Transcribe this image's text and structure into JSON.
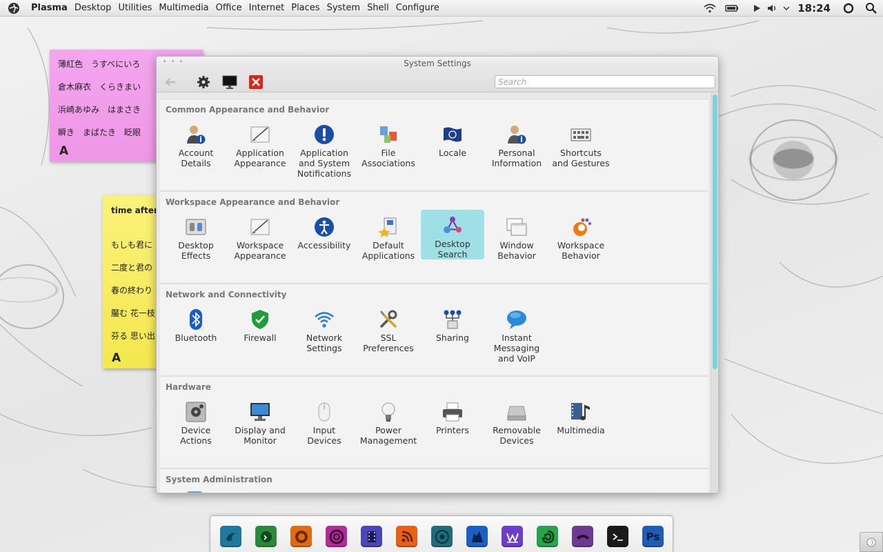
{
  "top_panel": {
    "menus": [
      "Plasma",
      "Desktop",
      "Utilities",
      "Multimedia",
      "Office",
      "Internet",
      "Places",
      "System",
      "Shell",
      "Configure"
    ],
    "clock": "18:24"
  },
  "notes": {
    "pink": {
      "lines": [
        "薄紅色　うすべにいろ",
        "倉木麻衣　くらきまい",
        "浜崎あゆみ　はまさき",
        "瞬き　まばたき　眨眼"
      ],
      "font_icon": "A"
    },
    "yellow": {
      "lines": [
        "time after",
        "もしも君に",
        "二度と君の",
        "春の終わり",
        "靨む 花一枝",
        "芬る 思い出"
      ],
      "font_icon": "A"
    }
  },
  "window": {
    "title": "System Settings",
    "search_placeholder": "Search",
    "sections": [
      {
        "title": "Common Appearance and Behavior",
        "items": [
          {
            "label": "Account\nDetails",
            "icon": "user-info-icon"
          },
          {
            "label": "Application\nAppearance",
            "icon": "appearance-icon"
          },
          {
            "label": "Application\nand System\nNotifications",
            "icon": "notification-icon"
          },
          {
            "label": "File\nAssociations",
            "icon": "file-assoc-icon"
          },
          {
            "label": "Locale",
            "icon": "locale-flag-icon"
          },
          {
            "label": "Personal\nInformation",
            "icon": "personal-info-icon"
          },
          {
            "label": "Shortcuts\nand Gestures",
            "icon": "keyboard-icon"
          }
        ]
      },
      {
        "title": "Workspace Appearance and Behavior",
        "items": [
          {
            "label": "Desktop\nEffects",
            "icon": "desktop-effects-icon"
          },
          {
            "label": "Workspace\nAppearance",
            "icon": "workspace-appearance-icon"
          },
          {
            "label": "Accessibility",
            "icon": "accessibility-icon"
          },
          {
            "label": "Default\nApplications",
            "icon": "default-apps-icon"
          },
          {
            "label": "Desktop\nSearch",
            "icon": "desktop-search-icon",
            "highlighted": true
          },
          {
            "label": "Window\nBehavior",
            "icon": "window-behavior-icon"
          },
          {
            "label": "Workspace\nBehavior",
            "icon": "workspace-behavior-icon"
          }
        ]
      },
      {
        "title": "Network and Connectivity",
        "items": [
          {
            "label": "Bluetooth",
            "icon": "bluetooth-icon"
          },
          {
            "label": "Firewall",
            "icon": "firewall-shield-icon"
          },
          {
            "label": "Network\nSettings",
            "icon": "wifi-icon"
          },
          {
            "label": "SSL\nPreferences",
            "icon": "tools-icon"
          },
          {
            "label": "Sharing",
            "icon": "sharing-icon"
          },
          {
            "label": "Instant\nMessaging\nand VoIP",
            "icon": "chat-bubble-icon"
          }
        ]
      },
      {
        "title": "Hardware",
        "items": [
          {
            "label": "Device\nActions",
            "icon": "device-actions-icon"
          },
          {
            "label": "Display and\nMonitor",
            "icon": "monitor-icon"
          },
          {
            "label": "Input\nDevices",
            "icon": "mouse-icon"
          },
          {
            "label": "Power\nManagement",
            "icon": "lightbulb-icon"
          },
          {
            "label": "Printers",
            "icon": "printer-icon"
          },
          {
            "label": "Removable\nDevices",
            "icon": "drive-icon"
          },
          {
            "label": "Multimedia",
            "icon": "multimedia-icon"
          }
        ]
      },
      {
        "title": "System Administration",
        "items": []
      }
    ]
  },
  "dock": {
    "apps": [
      {
        "name": "kde-app-icon",
        "color": "#1e7a9c"
      },
      {
        "name": "script-app-icon",
        "color": "#2b8a3a"
      },
      {
        "name": "firefox-icon",
        "color": "#e06a12"
      },
      {
        "name": "ring-app-icon",
        "color": "#b52a9a"
      },
      {
        "name": "video-app-icon",
        "color": "#4b46b8"
      },
      {
        "name": "rss-icon",
        "color": "#e8611a"
      },
      {
        "name": "chrome-icon",
        "color": "#1f6d7a"
      },
      {
        "name": "wolf-app-icon",
        "color": "#1c5fc4"
      },
      {
        "name": "wiki-app-icon",
        "color": "#6d3ec9"
      },
      {
        "name": "green-app-icon",
        "color": "#27a34b"
      },
      {
        "name": "phone-app-icon",
        "color": "#6c3a8e"
      },
      {
        "name": "terminal-icon",
        "color": "#1a1a1a"
      },
      {
        "name": "photoshop-icon",
        "color": "#1f5db4"
      }
    ],
    "labels": {
      "photoshop": "Ps"
    }
  }
}
